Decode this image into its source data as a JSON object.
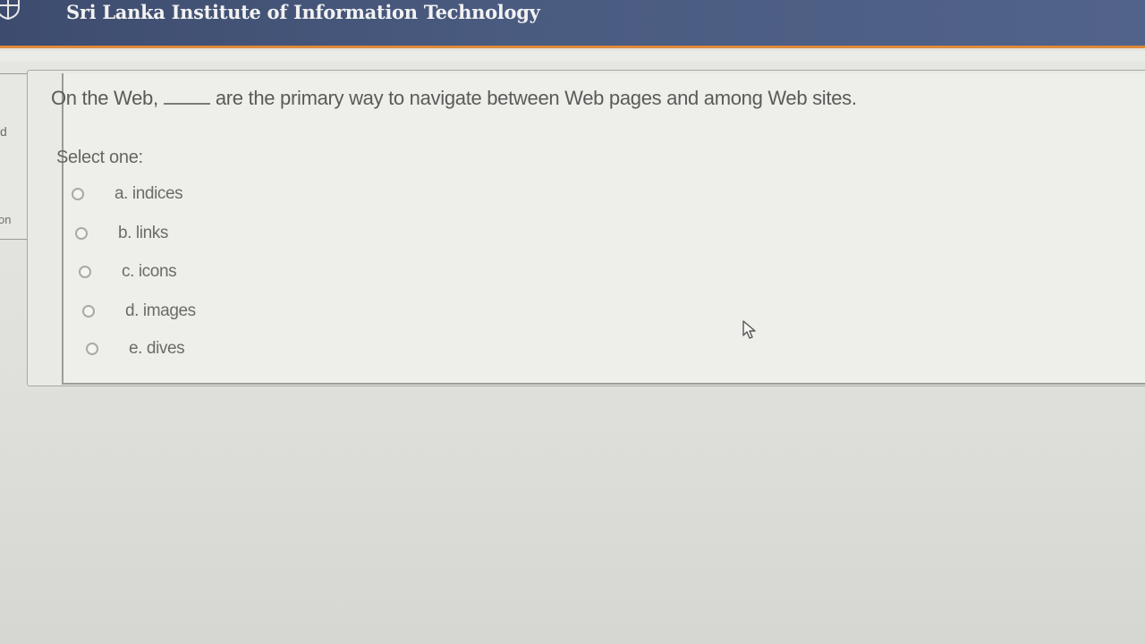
{
  "header": {
    "title": "Sri Lanka Institute of Information Technology",
    "accent_color": "#e08a3a",
    "bar_color": "#4a5b80",
    "logo_icon": "crest-icon"
  },
  "sidebar_fragments": {
    "top": "d",
    "bottom": "on"
  },
  "question": {
    "text_before": "On the Web,",
    "text_after": "are the primary way to navigate between Web pages and among Web sites.",
    "prompt": "Select one:",
    "options": [
      {
        "label": "a. indices",
        "selected": false
      },
      {
        "label": "b. links",
        "selected": false
      },
      {
        "label": "c. icons",
        "selected": false
      },
      {
        "label": "d. images",
        "selected": false
      },
      {
        "label": "e. dives",
        "selected": false
      }
    ]
  },
  "cursor_icon": "mouse-pointer-icon"
}
